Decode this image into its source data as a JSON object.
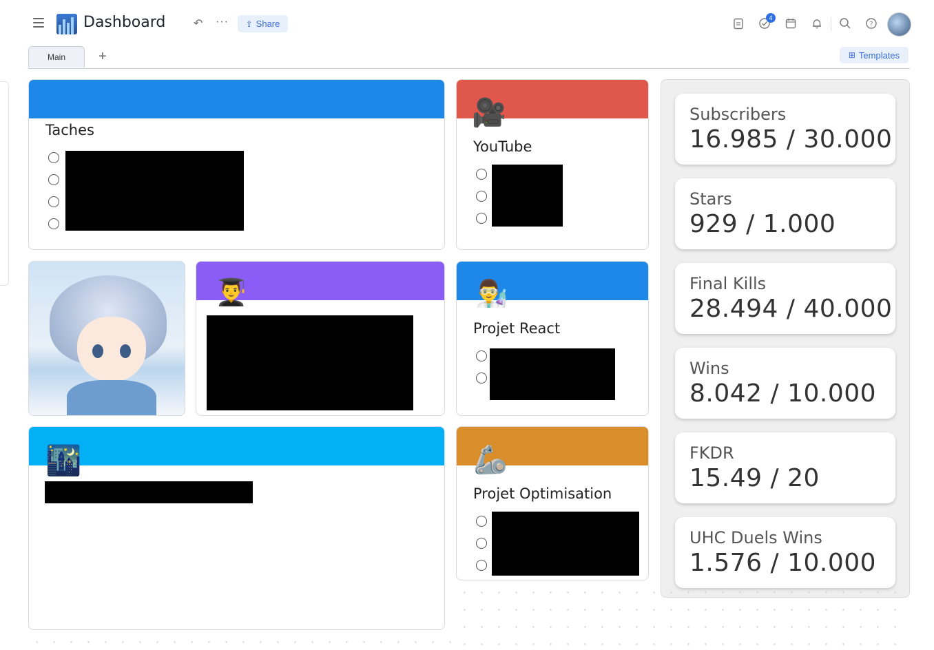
{
  "header": {
    "title": "Dashboard",
    "share_label": "Share",
    "tasks_badge": "4"
  },
  "tabs": {
    "items": [
      {
        "label": "Main"
      }
    ],
    "templates_label": "Templates"
  },
  "cards": {
    "taches": {
      "title": "Taches",
      "color": "#1e88e8"
    },
    "youtube": {
      "title": "YouTube",
      "color": "#e0574c",
      "emoji": "🎥"
    },
    "education": {
      "color": "#8b5cf6",
      "emoji": "👨‍🎓"
    },
    "react": {
      "title": "Projet React",
      "color": "#1e88e8",
      "emoji": "👨‍🔬"
    },
    "night": {
      "color": "#03b0f5",
      "emoji": "🌃"
    },
    "optimisation": {
      "title": "Projet Optimisation",
      "color": "#d98e2b",
      "emoji": "🦾"
    }
  },
  "stats": [
    {
      "label": "Subscribers",
      "value": "16.985 / 30.000"
    },
    {
      "label": "Stars",
      "value": "929 / 1.000"
    },
    {
      "label": "Final Kills",
      "value": "28.494 / 40.000"
    },
    {
      "label": "Wins",
      "value": "8.042 / 10.000"
    },
    {
      "label": "FKDR",
      "value": "15.49 / 20"
    },
    {
      "label": "UHC Duels Wins",
      "value": "1.576 / 10.000"
    }
  ],
  "icons": [
    "menu-icon",
    "undo-icon",
    "more-icon",
    "share-icon",
    "clipboard-icon",
    "task-check-icon",
    "calendar-icon",
    "bell-icon",
    "search-icon",
    "help-icon",
    "plus-icon",
    "templates-grid-icon"
  ]
}
